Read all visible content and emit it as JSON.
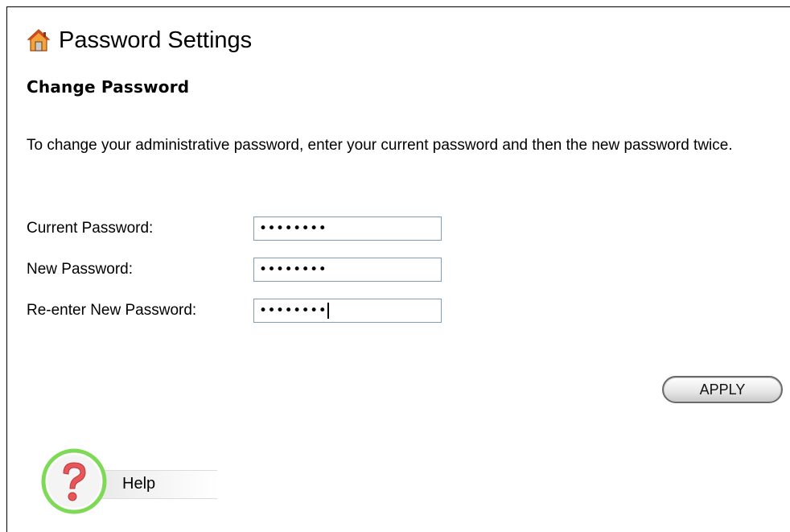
{
  "header": {
    "title": "Password Settings",
    "icon": "home-icon"
  },
  "section": {
    "title": "Change Password",
    "description": "To change your administrative password, enter your current password and then the new password twice."
  },
  "form": {
    "current_password": {
      "label": "Current Password:",
      "value": "••••••••"
    },
    "new_password": {
      "label": "New Password:",
      "value": "••••••••"
    },
    "reenter_password": {
      "label": "Re-enter New Password:",
      "value": "••••••••"
    }
  },
  "apply_label": "APPLY",
  "help": {
    "label": "Help",
    "icon": "help-icon"
  },
  "colors": {
    "input_border": "#7f9db9",
    "help_ring": "#7ed957",
    "help_mark": "#e8565a"
  }
}
